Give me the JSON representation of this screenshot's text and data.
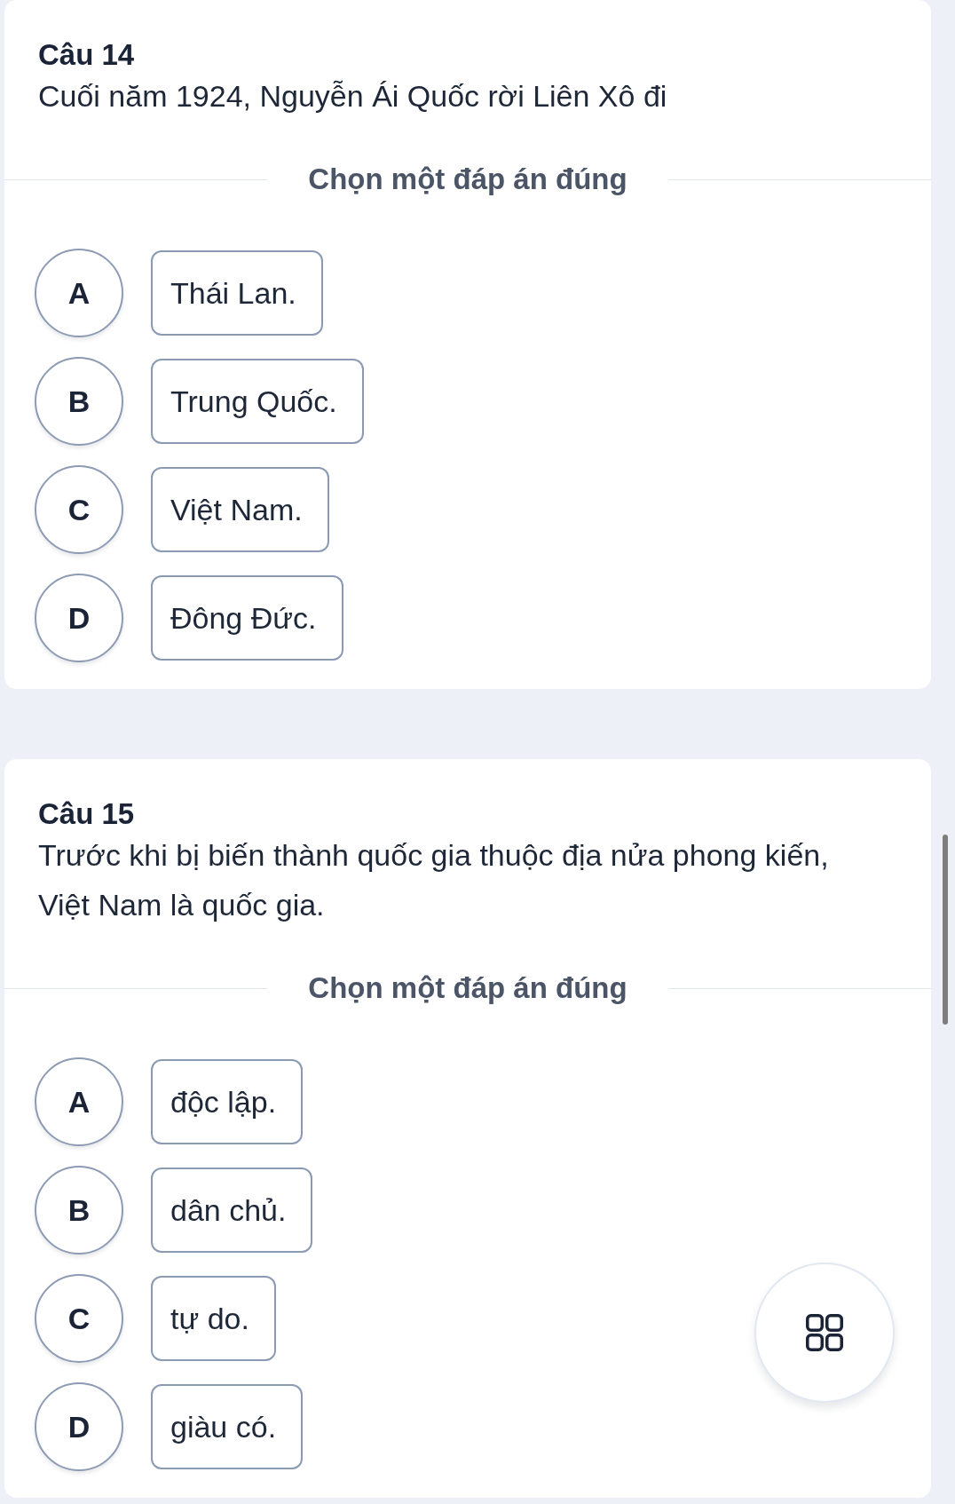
{
  "questions": [
    {
      "title": "Câu 14",
      "text": "Cuối năm 1924, Nguyễn Ái Quốc rời Liên Xô đi",
      "instruction": "Chọn một đáp án đúng",
      "options": [
        {
          "letter": "A",
          "text": "Thái Lan.",
          "selected": false
        },
        {
          "letter": "B",
          "text": "Trung Quốc.",
          "selected": false
        },
        {
          "letter": "C",
          "text": "Việt Nam.",
          "selected": false
        },
        {
          "letter": "D",
          "text": "Đông Đức.",
          "selected": false
        }
      ]
    },
    {
      "title": "Câu 15",
      "text": "Trước khi bị biến thành quốc gia thuộc địa nửa phong kiến, Việt Nam là quốc gia.",
      "instruction": "Chọn một đáp án đúng",
      "options": [
        {
          "letter": "A",
          "text": "độc lập.",
          "selected": false
        },
        {
          "letter": "B",
          "text": "dân chủ.",
          "selected": false
        },
        {
          "letter": "C",
          "text": "tự do.",
          "selected": false
        },
        {
          "letter": "D",
          "text": "giàu có.",
          "selected": false
        }
      ]
    }
  ]
}
